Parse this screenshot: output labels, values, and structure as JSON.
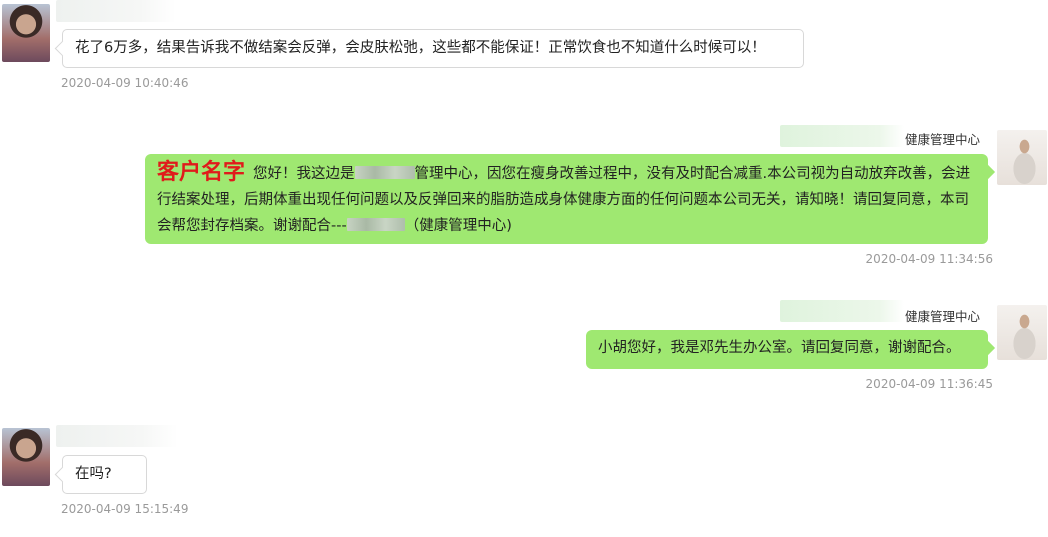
{
  "messages": [
    {
      "direction": "incoming",
      "text": "花了6万多，结果告诉我不做结案会反弹，会皮肤松弛，这些都不能保证！正常饮食也不知道什么时候可以！",
      "timestamp": "2020-04-09 10:40:46"
    },
    {
      "direction": "outgoing",
      "sender": "健康管理中心",
      "customer_name_label": "客户名字",
      "text_part1": "您好！我这边是",
      "text_part2": "管理中心，因您在瘦身改善过程中，没有及时配合减重.本公司视为自动放弃改善，会进行结案处理，后期体重出现任何问题以及反弹回来的脂肪造成身体健康方面的任何问题本公司无关，请知晓！请回复同意，本司会帮您封存档案。谢谢配合---",
      "text_part3": "（健康管理中心)",
      "timestamp": "2020-04-09 11:34:56"
    },
    {
      "direction": "outgoing",
      "sender": "健康管理中心",
      "text": "小胡您好，我是邓先生办公室。请回复同意，谢谢配合。",
      "timestamp": "2020-04-09 11:36:45"
    },
    {
      "direction": "incoming",
      "text": "在吗?",
      "timestamp": "2020-04-09 15:15:49"
    }
  ]
}
